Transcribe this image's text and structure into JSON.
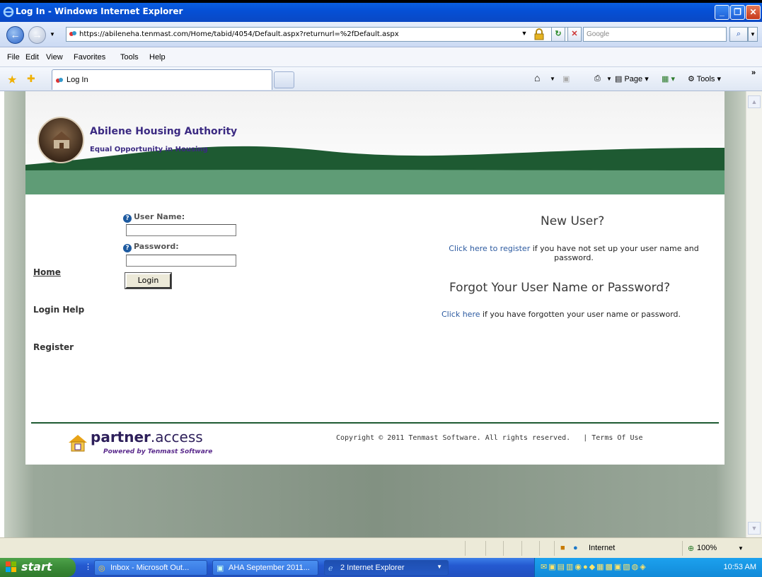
{
  "window": {
    "title": "Log In - Windows Internet Explorer"
  },
  "address": {
    "url": "https://abileneha.tenmast.com/Home/tabid/4054/Default.aspx?returnurl=%2fDefault.aspx",
    "search_placeholder": "Google"
  },
  "menu": {
    "items": [
      "File",
      "Edit",
      "View",
      "Favorites",
      "Tools",
      "Help"
    ]
  },
  "tabbar": {
    "tab_label": "Log In",
    "page_label": "Page",
    "tools_label": "Tools"
  },
  "site": {
    "org_name": "Abilene Housing Authority",
    "tagline": "Equal Opportunity in Housing"
  },
  "nav": {
    "home": "Home",
    "login_help": "Login Help",
    "register": "Register"
  },
  "login": {
    "username_label": "User Name:",
    "password_label": "Password:",
    "username_value": "",
    "password_value": "",
    "button_label": "Login"
  },
  "new_user": {
    "heading": "New User?",
    "link_text": "Click here to register",
    "text_line1": " if you have not set up your user name and",
    "text_line2": "password."
  },
  "forgot": {
    "heading": "Forgot Your User Name or Password?",
    "link_text": "Click here",
    "text": " if you have forgotten your user name or password."
  },
  "footer": {
    "brand_strong": "partner",
    "brand_rest": ".access",
    "brand_sub": "Powered by Tenmast Software",
    "copyright": "Copyright © 2011 Tenmast Software. All rights reserved.",
    "separator": "|",
    "terms": "Terms Of Use"
  },
  "status": {
    "zone": "Internet",
    "zoom": "100%"
  },
  "taskbar": {
    "start": "start",
    "tasks": [
      "Inbox - Microsoft Out...",
      "AHA September 2011...",
      "2 Internet Explorer"
    ],
    "time": "10:53 AM"
  }
}
